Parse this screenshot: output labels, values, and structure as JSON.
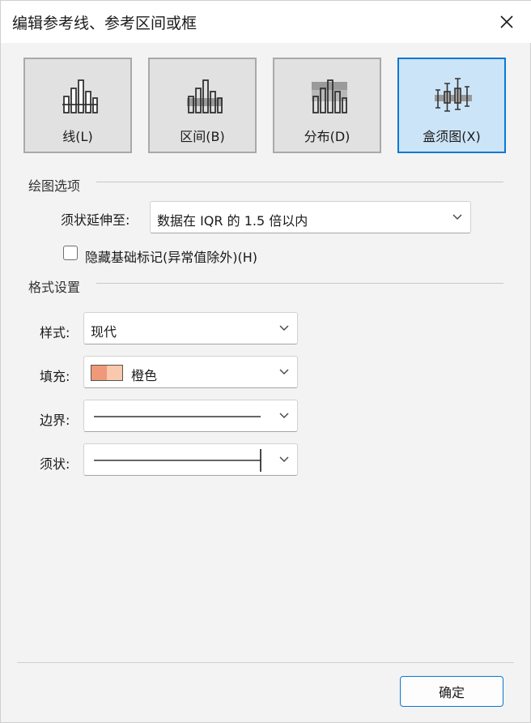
{
  "window": {
    "title": "编辑参考线、参考区间或框"
  },
  "types": [
    {
      "label": "线(L)"
    },
    {
      "label": "区间(B)"
    },
    {
      "label": "分布(D)"
    },
    {
      "label": "盒须图(X)",
      "selected": true
    }
  ],
  "plot_options": {
    "section_title": "绘图选项",
    "whisker_label": "须状延伸至:",
    "whisker_value": "数据在 IQR 的 1.5 倍以内",
    "hide_marks_label": "隐藏基础标记(异常值除外)(H)",
    "hide_marks_checked": false
  },
  "format": {
    "section_title": "格式设置",
    "style_label": "样式:",
    "style_value": "现代",
    "fill_label": "填充:",
    "fill_value": "橙色",
    "fill_colors": [
      "#f0987a",
      "#fac8ad"
    ],
    "border_label": "边界:",
    "whisker_label": "须状:"
  },
  "footer": {
    "ok_label": "确定"
  }
}
